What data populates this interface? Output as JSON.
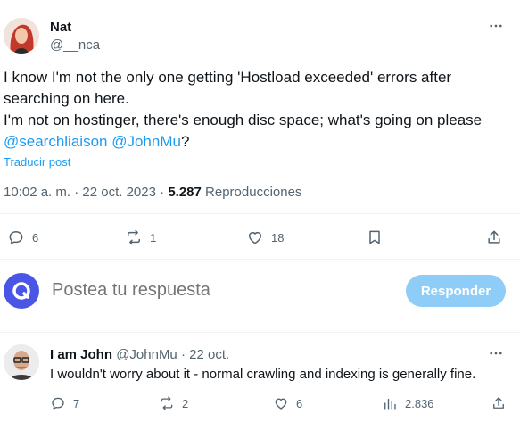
{
  "tweet": {
    "author_name": "Nat",
    "author_handle": "@__nca",
    "text_lines": [
      "I know I'm not the only one getting 'Hostload exceeded' errors after",
      "searching on here.",
      "I'm not on hostinger, there's enough disc space; what's going on please"
    ],
    "mention_1": "@searchliaison",
    "mention_2": "@JohnMu",
    "text_end": "?",
    "translate_label": "Traducir post",
    "time": "10:02 a. m.",
    "separator": " · ",
    "date": "22 oct. 2023",
    "views_count": "5.287",
    "views_label": "Reproducciones",
    "actions": {
      "replies": "6",
      "reposts": "1",
      "likes": "18"
    }
  },
  "composer": {
    "placeholder": "Postea tu respuesta",
    "button_label": "Responder"
  },
  "reply": {
    "author_name": "I am John",
    "author_handle": "@JohnMu",
    "separator": " · ",
    "date": "22 oct.",
    "text": "I wouldn't worry about it - normal crawling and indexing is generally fine.",
    "actions": {
      "replies": "7",
      "reposts": "2",
      "likes": "6",
      "views": "2.836"
    }
  },
  "colors": {
    "accent": "#1d9bf0",
    "muted": "#536471",
    "button_disabled": "#8ecdf8",
    "composer_avatar": "#4a55e6"
  },
  "icons": [
    "more-icon",
    "reply-icon",
    "repost-icon",
    "like-icon",
    "bookmark-icon",
    "share-icon",
    "views-icon"
  ]
}
